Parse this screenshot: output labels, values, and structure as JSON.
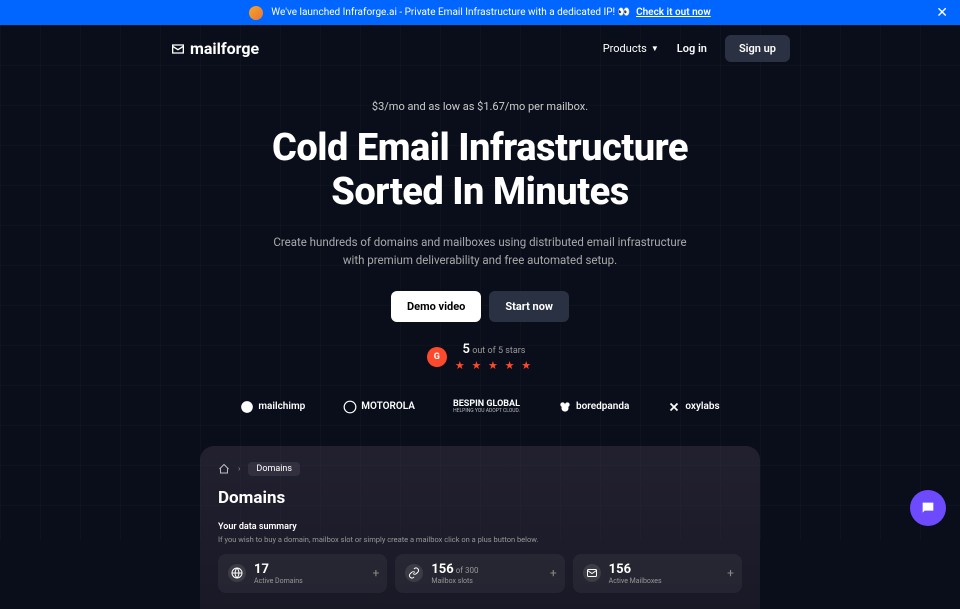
{
  "banner": {
    "text": "We've launched Infraforge.ai - Private Email Infrastructure with a dedicated IP! 👀",
    "link": "Check it out now"
  },
  "nav": {
    "logo": "mailforge",
    "products": "Products",
    "login": "Log in",
    "signup": "Sign up"
  },
  "hero": {
    "price": "$3/mo and as low as $1.67/mo per mailbox.",
    "title_line1": "Cold Email Infrastructure",
    "title_line2": "Sorted In Minutes",
    "desc": "Create hundreds of domains and mailboxes using distributed email infrastructure with premium deliverability and free automated setup.",
    "demo": "Demo video",
    "start": "Start now",
    "rating_num": "5",
    "rating_text": " out of 5 stars",
    "stars": "★ ★ ★ ★ ★"
  },
  "logos": {
    "mailchimp": "mailchimp",
    "motorola": "MOTOROLA",
    "bespin_main": "BESPIN GLOBAL",
    "bespin_sub": "HELPING YOU ADOPT CLOUD.",
    "boredpanda": "boredpanda",
    "oxylabs": "oxylabs"
  },
  "preview": {
    "breadcrumb": "Domains",
    "title": "Domains",
    "summary_label": "Your data summary",
    "summary_desc": "If you wish to buy a domain, mailbox slot or simply create a mailbox click on a plus button below.",
    "stats": [
      {
        "num": "17",
        "label": "Active Domains"
      },
      {
        "num": "156",
        "of": " of 300",
        "label": "Mailbox slots"
      },
      {
        "num": "156",
        "label": "Active Mailboxes"
      }
    ]
  }
}
